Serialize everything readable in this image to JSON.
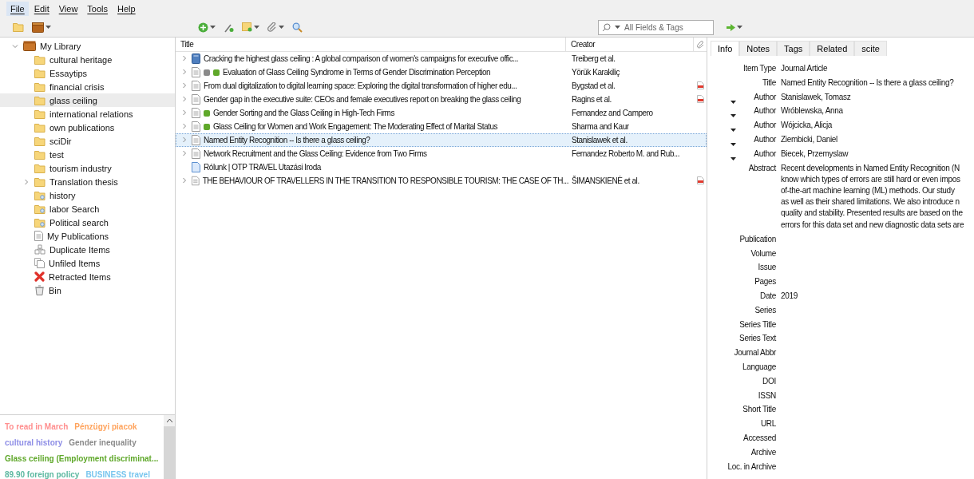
{
  "menu": [
    {
      "label": "File",
      "selected": true
    },
    {
      "label": "Edit",
      "selected": false
    },
    {
      "label": "View",
      "selected": false
    },
    {
      "label": "Tools",
      "selected": false
    },
    {
      "label": "Help",
      "selected": false
    }
  ],
  "search": {
    "placeholder": "All Fields & Tags"
  },
  "library": {
    "label": "My Library",
    "expanded": true,
    "selected": false,
    "children": [
      {
        "kind": "folder",
        "label": "cultural heritage",
        "selected": false,
        "expandable": false
      },
      {
        "kind": "folder",
        "label": "Essaytips",
        "selected": false,
        "expandable": false
      },
      {
        "kind": "folder",
        "label": "financial crisis",
        "selected": false,
        "expandable": false
      },
      {
        "kind": "folder",
        "label": "glass ceiling",
        "selected": true,
        "expandable": false
      },
      {
        "kind": "folder",
        "label": "international relations",
        "selected": false,
        "expandable": false
      },
      {
        "kind": "folder",
        "label": "own publications",
        "selected": false,
        "expandable": false
      },
      {
        "kind": "folder",
        "label": "sciDir",
        "selected": false,
        "expandable": false
      },
      {
        "kind": "folder",
        "label": "test",
        "selected": false,
        "expandable": false
      },
      {
        "kind": "folder",
        "label": "tourism industry",
        "selected": false,
        "expandable": false
      },
      {
        "kind": "folder",
        "label": "Translation thesis",
        "selected": false,
        "expandable": true
      },
      {
        "kind": "search",
        "label": "history",
        "selected": false,
        "expandable": false
      },
      {
        "kind": "search",
        "label": "labor Search",
        "selected": false,
        "expandable": false
      },
      {
        "kind": "search",
        "label": "Political search",
        "selected": false,
        "expandable": false
      },
      {
        "kind": "publications",
        "label": "My Publications",
        "selected": false,
        "expandable": false
      },
      {
        "kind": "duplicates",
        "label": "Duplicate Items",
        "selected": false,
        "expandable": false
      },
      {
        "kind": "unfiled",
        "label": "Unfiled Items",
        "selected": false,
        "expandable": false
      },
      {
        "kind": "retracted",
        "label": "Retracted Items",
        "selected": false,
        "expandable": false
      },
      {
        "kind": "bin",
        "label": "Bin",
        "selected": false,
        "expandable": false
      }
    ]
  },
  "tags": [
    {
      "label": "To read in March",
      "color": "#ff8f8f"
    },
    {
      "label": "Pénzügyi piacok",
      "color": "#ffa35c"
    },
    {
      "label": "cultural history",
      "color": "#8e8ee6"
    },
    {
      "label": "Gender inequality",
      "color": "#8a8a8a"
    },
    {
      "label": "Glass ceiling (Employment discriminat...",
      "color": "#5fa82a"
    },
    {
      "label": "89.90 foreign policy",
      "color": "#5cb8a0"
    },
    {
      "label": "BUSINESS travel",
      "color": "#7ac6ee"
    }
  ],
  "table": {
    "columns": [
      "Title",
      "Creator"
    ],
    "rows": [
      {
        "kind": "book",
        "title": "Cracking the highest glass ceiling : A global comparison of women's campaigns for executive offic...",
        "creator": "Treiberg et al.",
        "tag_colors": [],
        "pdf": false,
        "expandable": true,
        "selected": false
      },
      {
        "kind": "article",
        "title": "Evaluation of Glass Ceiling Syndrome in Terms of Gender Discrimination Perception",
        "creator": "Yörük Karakiliç",
        "tag_colors": [
          {
            "color": "#8a8a8a"
          },
          {
            "color": "#5fa82a"
          }
        ],
        "pdf": false,
        "expandable": true,
        "selected": false
      },
      {
        "kind": "article",
        "title": "From dual digitalization to digital learning space: Exploring the digital transformation of higher edu...",
        "creator": "Bygstad et al.",
        "tag_colors": [],
        "pdf": true,
        "expandable": true,
        "selected": false
      },
      {
        "kind": "article",
        "title": "Gender gap in the executive suite: CEOs and female executives report on breaking the glass ceiling",
        "creator": "Ragins et al.",
        "tag_colors": [],
        "pdf": true,
        "expandable": true,
        "selected": false
      },
      {
        "kind": "article",
        "title": "Gender Sorting and the Glass Ceiling in High-Tech Firms",
        "creator": "Fernandez and Campero",
        "tag_colors": [
          {
            "color": "#5fa82a"
          }
        ],
        "pdf": false,
        "expandable": true,
        "selected": false
      },
      {
        "kind": "article",
        "title": "Glass Ceiling for Women and Work Engagement: The Moderating Effect of Marital Status",
        "creator": "Sharma and Kaur",
        "tag_colors": [
          {
            "color": "#5fa82a"
          }
        ],
        "pdf": false,
        "expandable": true,
        "selected": false
      },
      {
        "kind": "article",
        "title": "Named Entity Recognition -- Is there a glass ceiling?",
        "creator": "Stanislawek et al.",
        "tag_colors": [],
        "pdf": false,
        "expandable": true,
        "selected": true
      },
      {
        "kind": "article",
        "title": "Network Recruitment and the Glass Ceiling: Evidence from Two Firms",
        "creator": "Fernandez Roberto M. and Rub...",
        "tag_colors": [],
        "pdf": false,
        "expandable": true,
        "selected": false
      },
      {
        "kind": "webpage",
        "title": "Rólunk | OTP TRAVEL Utazási Iroda",
        "tag_colors": [],
        "pdf": false,
        "expandable": false,
        "selected": false
      },
      {
        "kind": "article",
        "title": "THE BEHAVIOUR OF TRAVELLERS IN THE TRANSITION TO RESPONSIBLE TOURISM: THE CASE OF TH...",
        "creator": "ŠIMANSKIENĖ et al.",
        "tag_colors": [],
        "pdf": true,
        "expandable": true,
        "selected": false
      }
    ]
  },
  "pane_tabs": [
    {
      "label": "Info",
      "selected": true
    },
    {
      "label": "Notes",
      "selected": false
    },
    {
      "label": "Tags",
      "selected": false
    },
    {
      "label": "Related",
      "selected": false
    },
    {
      "label": "scite",
      "selected": false
    }
  ],
  "fields": [
    {
      "kind": "plain",
      "label": "Item Type",
      "value": "Journal Article"
    },
    {
      "kind": "plain",
      "label": "Title",
      "value": "Named Entity Recognition -- Is there a glass ceiling?"
    },
    {
      "kind": "author",
      "label": "Author",
      "value": "Stanislawek, Tomasz"
    },
    {
      "kind": "author",
      "label": "Author",
      "value": "Wróblewska, Anna"
    },
    {
      "kind": "author",
      "label": "Author",
      "value": "Wójcicka, Alicja"
    },
    {
      "kind": "author",
      "label": "Author",
      "value": "Ziembicki, Daniel"
    },
    {
      "kind": "author",
      "label": "Author",
      "value": "Biecek, Przemyslaw"
    },
    {
      "kind": "multiline",
      "label": "Abstract",
      "lines": [
        "Recent developments in Named Entity Recognition (N",
        "know which types of errors are still hard or even impos",
        "of-the-art machine learning (ML) methods. Our study",
        "as well as their shared limitations. We also introduce n",
        "quality and stability. Presented results are based on the",
        "errors for this data set and new diagnostic data sets are"
      ]
    },
    {
      "kind": "plain",
      "label": "Publication"
    },
    {
      "kind": "plain",
      "label": "Volume"
    },
    {
      "kind": "plain",
      "label": "Issue"
    },
    {
      "kind": "plain",
      "label": "Pages"
    },
    {
      "kind": "plain",
      "label": "Date",
      "value": "2019"
    },
    {
      "kind": "plain",
      "label": "Series"
    },
    {
      "kind": "plain",
      "label": "Series Title"
    },
    {
      "kind": "plain",
      "label": "Series Text"
    },
    {
      "kind": "plain",
      "label": "Journal Abbr"
    },
    {
      "kind": "plain",
      "label": "Language"
    },
    {
      "kind": "plain",
      "label": "DOI"
    },
    {
      "kind": "plain",
      "label": "ISSN"
    },
    {
      "kind": "plain",
      "label": "Short Title"
    },
    {
      "kind": "plain",
      "label": "URL"
    },
    {
      "kind": "plain",
      "label": "Accessed"
    },
    {
      "kind": "plain",
      "label": "Archive"
    },
    {
      "kind": "plain",
      "label": "Loc. in Archive"
    }
  ]
}
